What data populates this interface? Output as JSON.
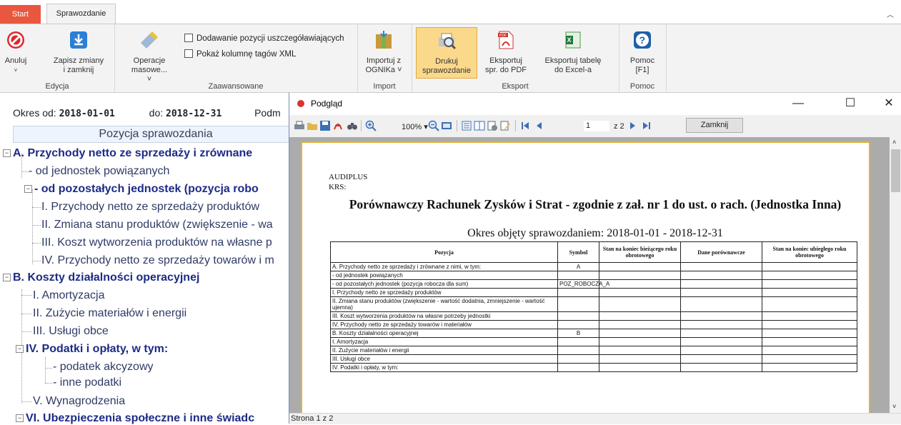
{
  "tabs": {
    "start": "Start",
    "report": "Sprawozdanie"
  },
  "ribbon": {
    "edit": {
      "label": "Edycja",
      "cancel": "Anuluj",
      "save_line1": "Zapisz zmiany",
      "save_line2": "i zamknij"
    },
    "advanced": {
      "label": "Zaawansowane",
      "bulk_line1": "Operacje",
      "bulk_line2": "masowe... ˅",
      "check_details": "Dodawanie pozycji uszczegóławiających",
      "check_xml": "Pokaż kolumnę tagów XML"
    },
    "import": {
      "label": "Import",
      "line1": "Importuj z",
      "line2": "OGNIKa ˅"
    },
    "export": {
      "label": "Eksport",
      "print_line1": "Drukuj",
      "print_line2": "sprawozdanie",
      "pdf_line1": "Eksportuj",
      "pdf_line2": "spr. do PDF",
      "excel_line1": "Eksportuj tabelę",
      "excel_line2": "do Excel-a"
    },
    "help": {
      "label": "Pomoc",
      "line1": "Pomoc",
      "line2": "[F1]"
    }
  },
  "period": {
    "from_label": "Okres od:",
    "from": "2018-01-01",
    "to_label": "do:",
    "to": "2018-12-31",
    "cut_label": "Podm"
  },
  "tree": {
    "header": "Pozycja sprawozdania",
    "nodes": [
      {
        "text": "A. Przychody netto ze sprzedaży i zrównane",
        "bold": true
      },
      {
        "text": "- od jednostek powiązanych",
        "bold": false
      },
      {
        "text": "- od pozostałych jednostek (pozycja robo",
        "bold": true
      },
      {
        "text": "I. Przychody netto ze sprzedaży produktów",
        "bold": false
      },
      {
        "text": "II. Zmiana stanu produktów (zwiększenie - wa",
        "bold": false
      },
      {
        "text": "III. Koszt wytworzenia produktów na własne p",
        "bold": false
      },
      {
        "text": "IV. Przychody netto ze sprzedaży towarów i m",
        "bold": false
      },
      {
        "text": "B. Koszty działalności operacyjnej",
        "bold": true
      },
      {
        "text": "I. Amortyzacja",
        "bold": false
      },
      {
        "text": "II. Zużycie materiałów i energii",
        "bold": false
      },
      {
        "text": "III. Usługi obce",
        "bold": false
      },
      {
        "text": "IV. Podatki i opłaty, w tym:",
        "bold": true
      },
      {
        "text": "- podatek akcyzowy",
        "bold": false
      },
      {
        "text": "- inne podatki",
        "bold": false
      },
      {
        "text": "V. Wynagrodzenia",
        "bold": false
      },
      {
        "text": "VI. Ubezpieczenia społeczne i inne świadc",
        "bold": true
      }
    ]
  },
  "preview": {
    "title": "Podgląd",
    "controls": {
      "minimize": "—",
      "maximize": "☐",
      "close": "✕"
    },
    "toolbar": {
      "zoom": "100% ▾",
      "page": "1",
      "page_count": "z 2",
      "close_button": "Zamknij"
    },
    "status": "Strona 1 z 2",
    "report": {
      "company": "AUDIPLUS",
      "krs": "KRS:",
      "title": "Porównawczy Rachunek Zysków i Strat - zgodnie z zał. nr 1 do ust. o rach. (Jednostka Inna)",
      "period": "Okres objęty sprawozdaniem: 2018-01-01 - 2018-12-31",
      "columns": [
        "Pozycja",
        "Symbol",
        "Stan na koniec bieżącego roku obrotowego",
        "Dane porównawcze",
        "Stan na koniec ubiegłego roku obrotowego"
      ],
      "rows": [
        [
          "A. Przychody netto ze sprzedaży i zrównane z nimi, w tym:",
          "A"
        ],
        [
          " - od jednostek powiązanych",
          ""
        ],
        [
          " - od pozostałych jednostek (pozycja robocza dla sum)",
          "POZ_ROBOCZA_A"
        ],
        [
          "  I. Przychody netto ze sprzedaży produktów",
          ""
        ],
        [
          "  II. Zmiana stanu produktów (zwiększenie - wartość dodatnia, zmniejszenie - wartość ujemna)",
          ""
        ],
        [
          "  III. Koszt wytworzenia produktów na własne potrzeby jednostki",
          ""
        ],
        [
          "  IV. Przychody netto ze sprzedaży towarów i materiałów",
          ""
        ],
        [
          "B. Koszty działalności operacyjnej",
          "B"
        ],
        [
          " I. Amortyzacja",
          ""
        ],
        [
          " II. Zużycie materiałów i energii",
          ""
        ],
        [
          " III. Usługi obce",
          ""
        ],
        [
          " IV. Podatki i opłaty, w tym:",
          ""
        ]
      ]
    }
  }
}
